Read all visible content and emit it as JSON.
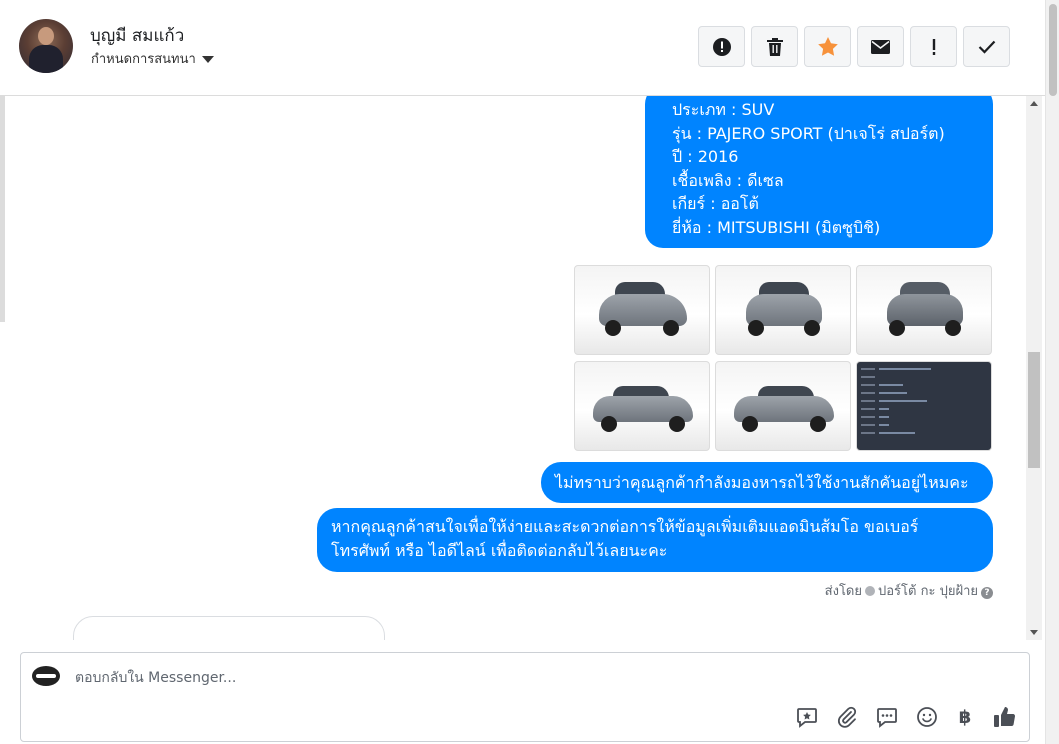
{
  "header": {
    "contact_name": "บุญมี สมแก้ว",
    "assign_label": "กำหนดการสนทนา",
    "actions": [
      {
        "icon": "exclamation-circle-icon",
        "label": "spam"
      },
      {
        "icon": "trash-icon",
        "label": "delete"
      },
      {
        "icon": "star-icon",
        "label": "star",
        "color": "#f7923b"
      },
      {
        "icon": "envelope-icon",
        "label": "mark unread"
      },
      {
        "icon": "exclamation-icon",
        "label": "follow up"
      },
      {
        "icon": "check-icon",
        "label": "done"
      }
    ]
  },
  "messages": {
    "car_details": [
      "ประเภท : SUV",
      "รุ่น : PAJERO SPORT (ปาเจโร่ สปอร์ต)",
      "ปี : 2016",
      "เชื้อเพลิง : ดีเซล",
      "เกียร์ : ออโต้",
      "ยี่ห้อ : MITSUBISHI (มิตซูบิชิ)"
    ],
    "photos": [
      {
        "view": "front-left"
      },
      {
        "view": "front"
      },
      {
        "view": "rear"
      },
      {
        "view": "side-left"
      },
      {
        "view": "side-right"
      },
      {
        "view": "info-screenshot"
      }
    ],
    "question": "ไม่ทราบว่าคุณลูกค้ากำลังมองหารถไว้ใช้งานสักคันอยู่ไหมคะ",
    "contact_request": [
      "หากคุณลูกค้าสนใจเพื่อให้ง่ายและสะดวกต่อการให้ข้อมูลเพิ่มเติมแอดมินส้มโอ ขอเบอร์",
      "โทรศัพท์ หรือ ไอดีไลน์ เพื่อติดต่อกลับไว้เลยนะคะ"
    ],
    "sent_by_prefix": "ส่งโดย",
    "sent_by_name": "ปอร์โต้ กะ ปุยฝ้าย"
  },
  "composer": {
    "placeholder": "ตอบกลับใน Messenger...",
    "tools": [
      "saved-reply-icon",
      "paperclip-icon",
      "chat-bubble-icon",
      "emoji-icon",
      "baht-icon",
      "thumbs-up-icon"
    ],
    "currency_symbol": "฿"
  },
  "colors": {
    "bubble": "#0084ff",
    "star": "#f7923b"
  }
}
